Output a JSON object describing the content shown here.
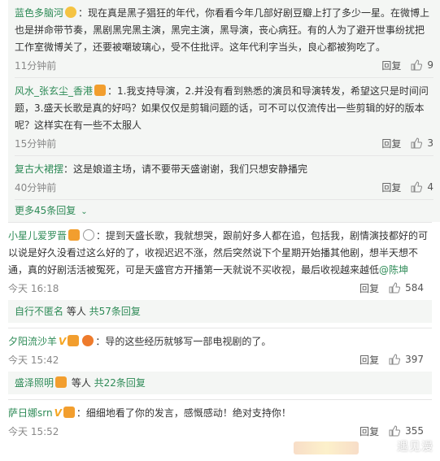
{
  "nested_replies": [
    {
      "user": "蓝色多脑河",
      "text": "：现在真是黑子猖狂的年代，你看看今年几部好剧豆瓣上打了多少一星。在微博上也是拼命带节奏，黑剧黑完黑主演，黑完主演，黑导演，丧心病狂。有的人为了避开世事纷扰把工作室微博关了，还要被嘲玻璃心，受不住批评。这年代利字当头，良心都被狗吃了。",
      "time": "11分钟前",
      "reply_label": "回复",
      "likes": "9"
    },
    {
      "user": "风水_张玄尘_香港",
      "text": "：1.我支持导演，2.并没有看到熟悉的演员和导演转发，希望这只是时间问题，3.盛天长歌是真的好吗？如果仅仅是剪辑问题的话，可不可以仅流传出一些剪辑的好的版本呢？这样实在有一些不太服人",
      "time": "15分钟前",
      "reply_label": "回复",
      "likes": "3"
    },
    {
      "user": "复古大裙摆",
      "text": "：这是娘道主场，请不要带天盛谢谢，我们只想安静播完",
      "time": "40分钟前",
      "reply_label": "回复",
      "likes": "4"
    }
  ],
  "more_replies": "更多45条回复",
  "comments": [
    {
      "user": "小星儿爱罗晋",
      "text": "：提到天盛长歌，我就想哭，跟前好多人都在追，包括我，剧情演技都好的可以说是好久没看过这么好的了，收视迟迟不涨，然后突然说下个星期开始播其他剧，想半天想不通，真的好剧活活被冤死，可是天盛官方开播第一天就说不买收视，最后收视越来越低",
      "mention": "@陈坤",
      "time": "今天 16:18",
      "reply_label": "回复",
      "likes": "584",
      "sub_user": "自行不匿名",
      "sub_mid": " 等人 ",
      "sub_count": "共57条回复"
    },
    {
      "user": "夕阳流沙羊",
      "text": "：导的这些经历就够写一部电视剧的了。",
      "time": "今天 15:42",
      "reply_label": "回复",
      "likes": "397",
      "sub_user": "盛泽照明",
      "sub_mid": " 等人 ",
      "sub_count": "共22条回复"
    },
    {
      "user": "萨日娜srn",
      "text": "：细细地看了你的发言，感慨感动！绝对支持你！",
      "time": "今天 15:52",
      "reply_label": "回复",
      "likes": "355"
    }
  ],
  "watermark": "遇见漫"
}
